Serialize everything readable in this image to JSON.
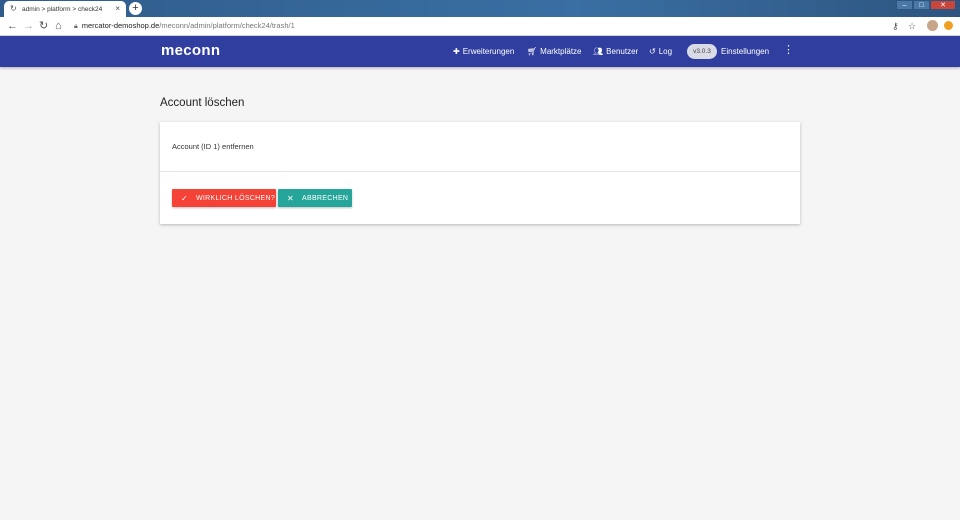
{
  "browser": {
    "tab_title": "admin > platform > check24",
    "tab_close": "×",
    "new_tab": "+",
    "url_host": "mercator-demoshop.de",
    "url_path": "/meconn/admin/platform/check24/trash/1"
  },
  "app": {
    "logo": "meconn",
    "nav": {
      "extensions": "Erweiterungen",
      "marketplaces": "Marktplätze",
      "users": "Benutzer",
      "log": "Log",
      "version": "v3.0.3",
      "settings": "Einstellungen"
    }
  },
  "page": {
    "title": "Account löschen",
    "message": "Account (ID 1) entfernen",
    "confirm_button": "WIRKLICH LÖSCHEN?",
    "cancel_button": "ABBRECHEN"
  },
  "colors": {
    "appbar": "#303f9f",
    "danger": "#f44336",
    "cancel": "#26a69a"
  },
  "icons": {
    "extensions": "puzzle-icon",
    "marketplaces": "cart-icon",
    "users": "people-icon",
    "log": "history-icon",
    "more": "more-vert-icon",
    "confirm": "check-icon",
    "cancel": "close-icon"
  }
}
